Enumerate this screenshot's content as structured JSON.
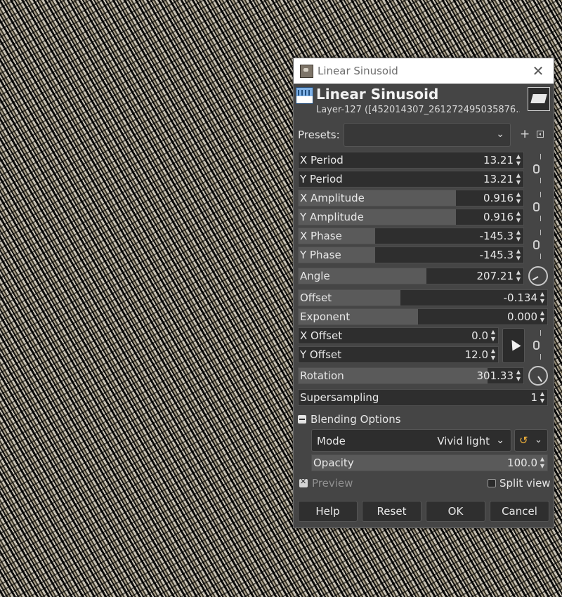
{
  "window": {
    "title": "Linear Sinusoid",
    "close_glyph": "✕"
  },
  "header": {
    "filter_name": "Linear Sinusoid",
    "layer_name": "Layer-127 ([452014307_261272495035876..."
  },
  "presets": {
    "label": "Presets:",
    "value": "",
    "add_glyph": "+"
  },
  "params": [
    {
      "label": "X Period",
      "value": "13.21",
      "fraction": 0.0
    },
    {
      "label": "Y Period",
      "value": "13.21",
      "fraction": 0.0
    },
    {
      "label": "X Amplitude",
      "value": "0.916",
      "fraction": 0.7
    },
    {
      "label": "Y Amplitude",
      "value": "0.916",
      "fraction": 0.7
    },
    {
      "label": "X Phase",
      "value": "-145.3",
      "fraction": 0.34
    },
    {
      "label": "Y Phase",
      "value": "-145.3",
      "fraction": 0.34
    }
  ],
  "angle": {
    "label": "Angle",
    "value": "207.21",
    "fraction": 0.57
  },
  "offset": {
    "label": "Offset",
    "value": "-0.134",
    "fraction": 0.41
  },
  "exponent": {
    "label": "Exponent",
    "value": "0.000",
    "fraction": 0.48
  },
  "x_offset": {
    "label": "X Offset",
    "value": "0.0"
  },
  "y_offset": {
    "label": "Y Offset",
    "value": "12.0"
  },
  "rotation": {
    "label": "Rotation",
    "value": "301.33",
    "fraction": 0.84
  },
  "supersampling": {
    "label": "Supersampling",
    "value": "1"
  },
  "blending": {
    "section_label": "Blending Options",
    "mode_label": "Mode",
    "mode_value": "Vivid light",
    "opacity_label": "Opacity",
    "opacity_value": "100.0"
  },
  "preview": {
    "preview_label": "Preview",
    "split_label": "Split view"
  },
  "buttons": {
    "help": "Help",
    "reset": "Reset",
    "ok": "OK",
    "cancel": "Cancel"
  }
}
